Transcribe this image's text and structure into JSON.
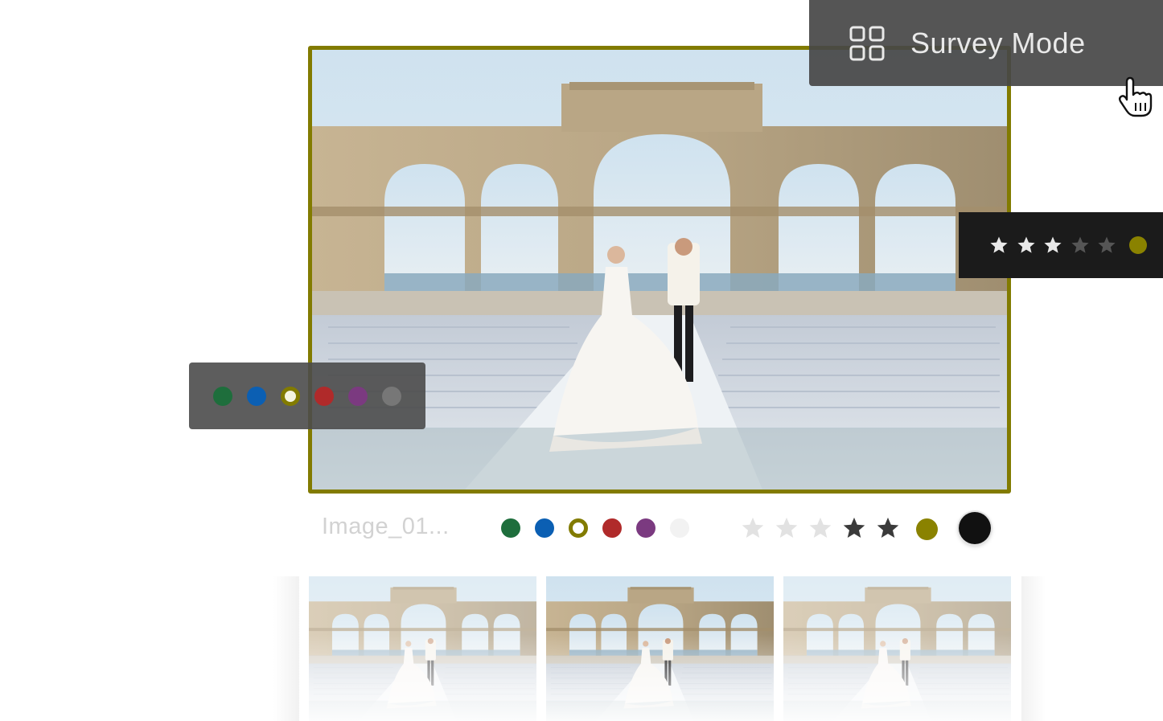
{
  "survey_mode": {
    "label": "Survey Mode",
    "icon": "grid-icon"
  },
  "cursor": {
    "icon": "hand-pointer-icon"
  },
  "main_photo": {
    "icon": "wedding-photo",
    "selected": true,
    "frame_color": "#827b00"
  },
  "rating_overlay": {
    "rating": 3,
    "max": 5,
    "label_color": "#8a8200"
  },
  "color_overlay": {
    "labels": [
      {
        "name": "green",
        "color": "#1e6e3c",
        "selected": false
      },
      {
        "name": "blue",
        "color": "#0b5fb3",
        "selected": false
      },
      {
        "name": "olive",
        "color": "#827b00",
        "selected": true
      },
      {
        "name": "red",
        "color": "#b02a2a",
        "selected": false
      },
      {
        "name": "purple",
        "color": "#7b3a80",
        "selected": false
      },
      {
        "name": "gray",
        "color": "#777777",
        "selected": false
      }
    ]
  },
  "info_bar": {
    "filename": "Image_01...",
    "color_labels": [
      {
        "name": "green",
        "color": "#1e6e3c",
        "selected": false
      },
      {
        "name": "blue",
        "color": "#0b5fb3",
        "selected": false
      },
      {
        "name": "olive",
        "color": "#827b00",
        "selected": true
      },
      {
        "name": "red",
        "color": "#b02a2a",
        "selected": false
      },
      {
        "name": "purple",
        "color": "#7b3a80",
        "selected": false
      },
      {
        "name": "none",
        "color": "#f2f2f2",
        "selected": false
      }
    ],
    "stars": [
      "light",
      "light",
      "light",
      "dark",
      "dark"
    ],
    "accent_color": "#8a8200",
    "swatch_color": "#111111"
  },
  "filmstrip": {
    "thumbnails": [
      {
        "name": "thumb-1",
        "active": false
      },
      {
        "name": "thumb-2",
        "active": true
      },
      {
        "name": "thumb-3",
        "active": false
      }
    ]
  }
}
